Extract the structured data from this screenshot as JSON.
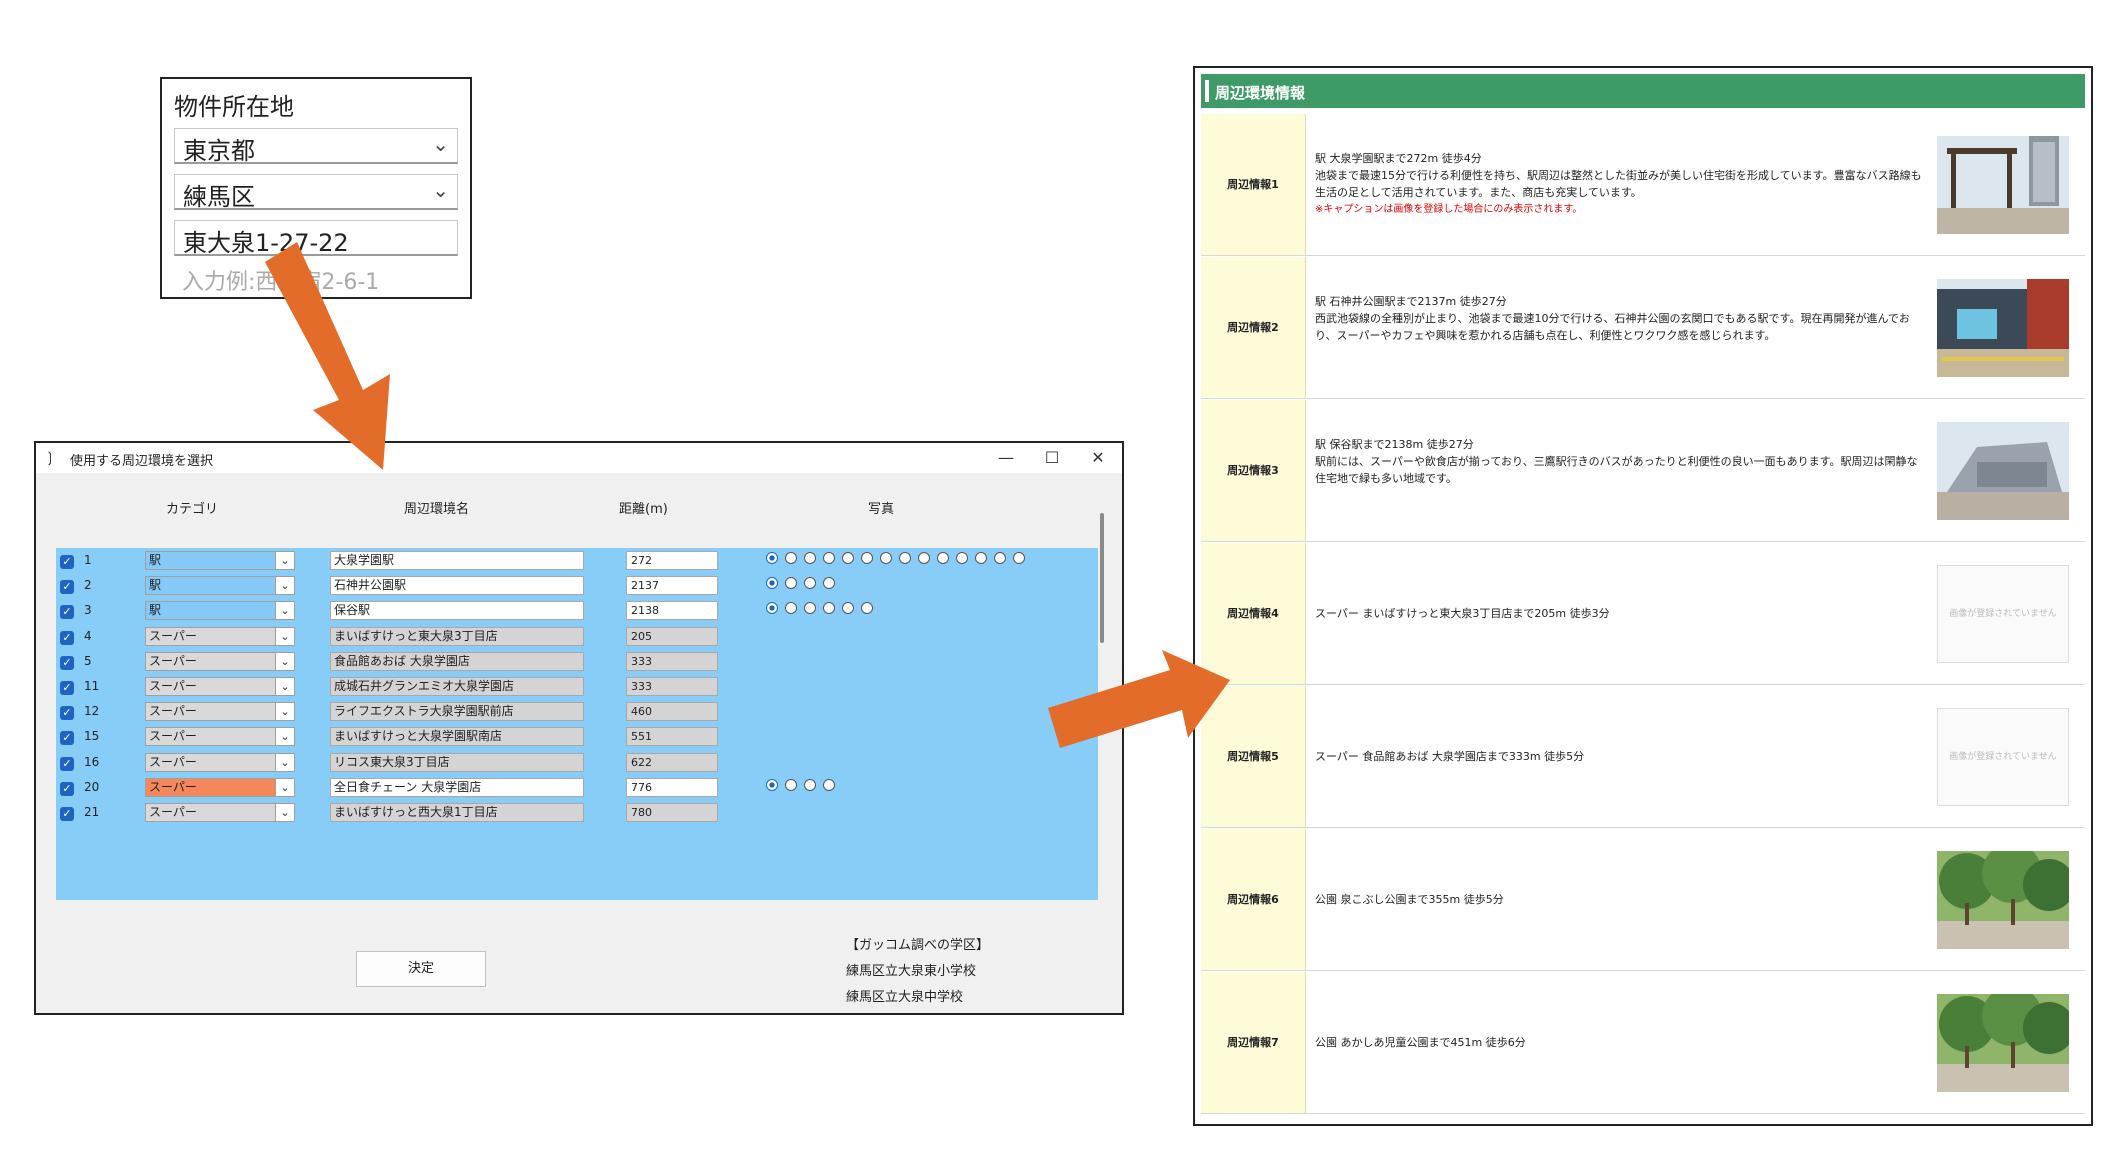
{
  "colors": {
    "accent_green": "#3e9a67",
    "grid_blue": "#87cdf8",
    "arrow_orange": "#e36c2a",
    "highlight_orange": "#f4885a",
    "label_cream": "#fefbd8"
  },
  "address": {
    "label": "物件所在地",
    "prefecture": "東京都",
    "ward": "練馬区",
    "street_value": "東大泉1-27-22",
    "street_placeholder": "入力例:西新宿2-6-1"
  },
  "dialog": {
    "title": "使用する周辺環境を選択",
    "icon": "wifi-icon",
    "headers": {
      "category": "カテゴリ",
      "name": "周辺環境名",
      "distance": "距離(m)",
      "photo": "写真"
    },
    "rows": [
      {
        "num": "1",
        "category": "駅",
        "name": "大泉学園駅",
        "distance": "272",
        "photos": 14
      },
      {
        "num": "2",
        "category": "駅",
        "name": "石神井公園駅",
        "distance": "2137",
        "photos": 4
      },
      {
        "num": "3",
        "category": "駅",
        "name": "保谷駅",
        "distance": "2138",
        "photos": 6
      },
      {
        "num": "4",
        "category": "スーパー",
        "name": "まいばすけっと東大泉3丁目店",
        "distance": "205",
        "photos": 0
      },
      {
        "num": "5",
        "category": "スーパー",
        "name": "食品館あおば 大泉学園店",
        "distance": "333",
        "photos": 0
      },
      {
        "num": "11",
        "category": "スーパー",
        "name": "成城石井グランエミオ大泉学園店",
        "distance": "333",
        "photos": 0
      },
      {
        "num": "12",
        "category": "スーパー",
        "name": "ライフエクストラ大泉学園駅前店",
        "distance": "460",
        "photos": 0
      },
      {
        "num": "15",
        "category": "スーパー",
        "name": "まいばすけっと大泉学園駅南店",
        "distance": "551",
        "photos": 0
      },
      {
        "num": "16",
        "category": "スーパー",
        "name": "リコス東大泉3丁目店",
        "distance": "622",
        "photos": 0
      },
      {
        "num": "20",
        "category": "スーパー",
        "name": "全日食チェーン 大泉学園店",
        "distance": "776",
        "photos": 4
      },
      {
        "num": "21",
        "category": "スーパー",
        "name": "まいばすけっと西大泉1丁目店",
        "distance": "780",
        "photos": 0
      }
    ],
    "decide_label": "決定",
    "school_heading": "【ガッコム調べの学区】",
    "schools": [
      "練馬区立大泉東小学校",
      "練馬区立大泉中学校"
    ]
  },
  "panel": {
    "title": "周辺環境情報",
    "rows": [
      {
        "label": "周辺情報1",
        "lines": [
          "駅 大泉学園駅まで272m 徒歩4分",
          "池袋まで最速15分で行ける利便性を持ち、駅周辺は整然とした街並みが美しい住宅街を形成しています。豊富なバス路線も生活の足として活用されています。また、商店も充実しています。"
        ],
        "note": "※キャプションは画像を登録した場合にのみ表示されます。",
        "photo": "station"
      },
      {
        "label": "周辺情報2",
        "lines": [
          "駅 石神井公園駅まで2137m 徒歩27分",
          "西武池袋線の全種別が止まり、池袋まで最速10分で行ける、石神井公園の玄関口でもある駅です。現在再開発が進んでおり、スーパーやカフェや興味を惹かれる店舗も点在し、利便性とワクワク感を感じられます。"
        ],
        "note": "",
        "photo": "station2"
      },
      {
        "label": "周辺情報3",
        "lines": [
          "駅 保谷駅まで2138m 徒歩27分",
          "駅前には、スーパーや飲食店が揃っており、三鷹駅行きのバスがあったりと利便性の良い一面もあります。駅周辺は閑静な住宅地で緑も多い地域です。"
        ],
        "note": "",
        "photo": "station3"
      },
      {
        "label": "周辺情報4",
        "lines": [
          "スーパー まいばすけっと東大泉3丁目店まで205m 徒歩3分"
        ],
        "note": "",
        "photo": "none"
      },
      {
        "label": "周辺情報5",
        "lines": [
          "スーパー 食品館あおば 大泉学園店まで333m 徒歩5分"
        ],
        "note": "",
        "photo": "none"
      },
      {
        "label": "周辺情報6",
        "lines": [
          "公園 泉こぶし公園まで355m 徒歩5分"
        ],
        "note": "",
        "photo": "park"
      },
      {
        "label": "周辺情報7",
        "lines": [
          "公園 あかしあ児童公園まで451m 徒歩6分"
        ],
        "note": "",
        "photo": "park2"
      }
    ],
    "no_image_text": "画像が登録されていません"
  }
}
